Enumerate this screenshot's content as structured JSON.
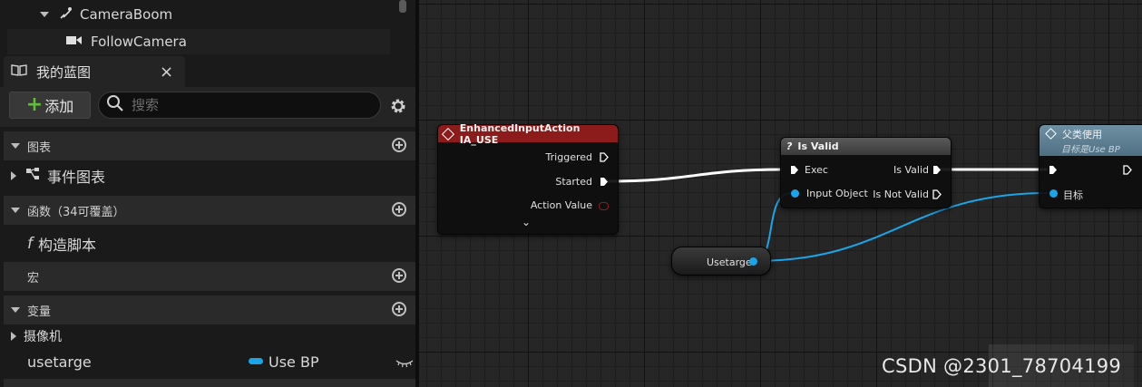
{
  "components": {
    "rows": [
      {
        "label": "CameraBoom"
      },
      {
        "label": "FollowCamera"
      }
    ]
  },
  "panel": {
    "tab_title": "我的蓝图",
    "close_glyph": "×",
    "add_label": "添加",
    "search_placeholder": "搜索"
  },
  "sections": {
    "graphs": {
      "title": "图表",
      "items": [
        "事件图表"
      ]
    },
    "functions": {
      "title": "函数（34可覆盖）",
      "items": [
        "构造脚本"
      ]
    },
    "macros": {
      "title": "宏"
    },
    "variables": {
      "title": "变量",
      "category": "摄像机",
      "var_name": "usetarge",
      "var_type": "Use BP",
      "var_type_color": "#1ba5e8"
    }
  },
  "graph": {
    "event_node": {
      "title": "EnhancedInputAction IA_USE",
      "header_color": "#8c1c1c",
      "pins": [
        "Triggered",
        "Started",
        "Action Value"
      ]
    },
    "isvalid_node": {
      "title": "Is Valid",
      "title_glyph": "?",
      "inputs": [
        "Exec",
        "Input Object"
      ],
      "outputs": [
        "Is Valid",
        "Is Not Valid"
      ]
    },
    "parent_node": {
      "title": "父类使用",
      "subtitle": "目标是Use BP",
      "header_color": "#5f7f93",
      "inputs": [
        "目标"
      ]
    },
    "var_node": {
      "label": "Usetarge"
    },
    "object_pin_color": "#1ba5e8",
    "exec_wire_color": "#ffffff"
  },
  "watermark": "CSDN @2301_78704199"
}
